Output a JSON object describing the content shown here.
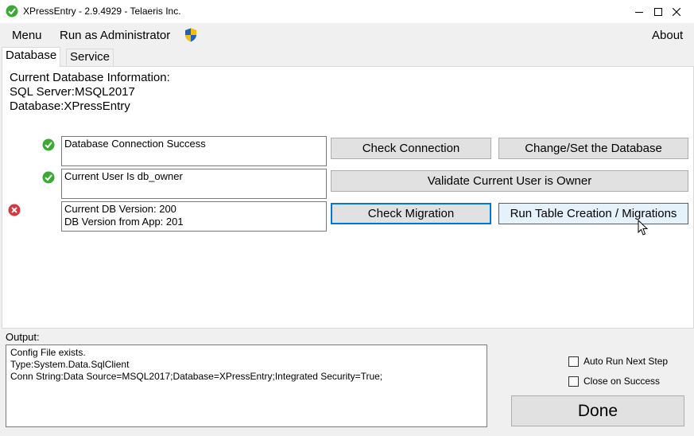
{
  "window": {
    "title": "XPressEntry - 2.9.4929 - Telaeris Inc.",
    "app_icon": "check-circle-icon",
    "controls": [
      "minimize-icon",
      "maximize-icon",
      "close-icon"
    ]
  },
  "menubar": {
    "menu": "Menu",
    "run_as_admin": "Run as Administrator",
    "admin_icon": "uac-shield-icon",
    "about": "About"
  },
  "tabs": [
    {
      "label": "Database",
      "active": true
    },
    {
      "label": "Service",
      "active": false
    }
  ],
  "database_info": {
    "heading": "Current Database Information:",
    "sql_server": "SQL Server:MSQL2017",
    "database": "Database:XPressEntry"
  },
  "checks": [
    {
      "status": "success",
      "icon": "green-check-icon",
      "lines": [
        "Database Connection Success"
      ]
    },
    {
      "status": "success",
      "icon": "green-check-icon",
      "lines": [
        "Current User Is db_owner"
      ]
    },
    {
      "status": "error",
      "icon": "red-x-icon",
      "lines": [
        "Current DB Version: 200",
        "DB Version from App: 201"
      ]
    }
  ],
  "buttons": {
    "check_connection": "Check Connection",
    "change_database": "Change/Set the Database",
    "validate_owner": "Validate Current User is Owner",
    "check_migration": "Check Migration",
    "run_migrations": "Run Table Creation / Migrations",
    "done": "Done"
  },
  "output": {
    "label": "Output:",
    "lines": [
      "Config File exists.",
      "Type:System.Data.SqlClient",
      "Conn String:Data Source=MSQL2017;Database=XPressEntry;Integrated Security=True;"
    ]
  },
  "options": {
    "auto_run": {
      "label": "Auto Run Next Step",
      "checked": false
    },
    "close_on_success": {
      "label": "Close on Success",
      "checked": false
    }
  },
  "colors": {
    "success": "#3aaa35",
    "error": "#d9363e",
    "focus": "#0078d7"
  }
}
